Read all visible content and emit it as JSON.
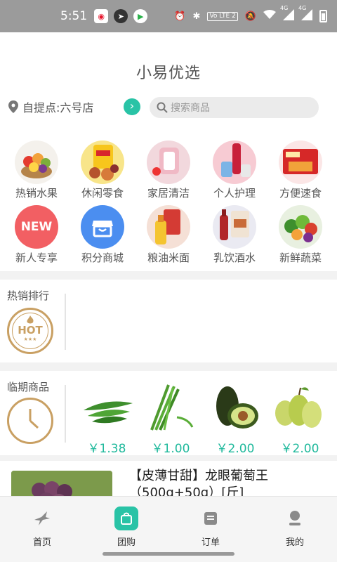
{
  "status_bar": {
    "time": "5:51",
    "icons": [
      "weibo-icon",
      "compass-icon",
      "video-app-icon",
      "alarm-icon",
      "bluetooth-icon",
      "volte-icon",
      "mute-icon",
      "wifi-icon",
      "signal-4g-icon",
      "signal-4g-icon",
      "battery-icon"
    ],
    "volte_label": "Vo LTE 2",
    "net1": "4G",
    "net2": "4G"
  },
  "header": {
    "title": "小易优选",
    "pickup_label": "自提点:六号店",
    "search_placeholder": "搜索商品"
  },
  "categories": [
    {
      "label": "热销水果",
      "icon": "fruit-basket-image"
    },
    {
      "label": "休闲零食",
      "icon": "snacks-image"
    },
    {
      "label": "家居清洁",
      "icon": "home-cleaning-image"
    },
    {
      "label": "个人护理",
      "icon": "personal-care-image"
    },
    {
      "label": "方便速食",
      "icon": "instant-food-image"
    },
    {
      "label": "新人专享",
      "icon": "new-badge",
      "badge_text": "NEW"
    },
    {
      "label": "积分商城",
      "icon": "points-shop-icon"
    },
    {
      "label": "粮油米面",
      "icon": "grain-oil-image"
    },
    {
      "label": "乳饮酒水",
      "icon": "drinks-image"
    },
    {
      "label": "新鲜蔬菜",
      "icon": "vegetables-image"
    }
  ],
  "hot_rank": {
    "title": "热销排行",
    "badge_text": "HOT",
    "badge_stars": "★★★"
  },
  "expiring": {
    "title": "临期商品",
    "products": [
      {
        "name": "okra",
        "price": "￥1.38"
      },
      {
        "name": "garlic-chives",
        "price": "￥1.00"
      },
      {
        "name": "avocado",
        "price": "￥2.00"
      },
      {
        "name": "pear",
        "price": "￥2.00"
      }
    ]
  },
  "featured_item": {
    "title": "【皮薄甘甜】龙眼葡萄王（500g+50g）[斤]"
  },
  "tabs": [
    {
      "label": "首页",
      "icon": "home-bird-icon"
    },
    {
      "label": "团购",
      "icon": "group-buy-bag-icon",
      "active": true
    },
    {
      "label": "订单",
      "icon": "orders-icon"
    },
    {
      "label": "我的",
      "icon": "profile-icon"
    }
  ],
  "colors": {
    "accent": "#29c3a6",
    "price": "#1fb99c",
    "gold": "#c9a063",
    "status_bar": "#9b9b9b"
  }
}
